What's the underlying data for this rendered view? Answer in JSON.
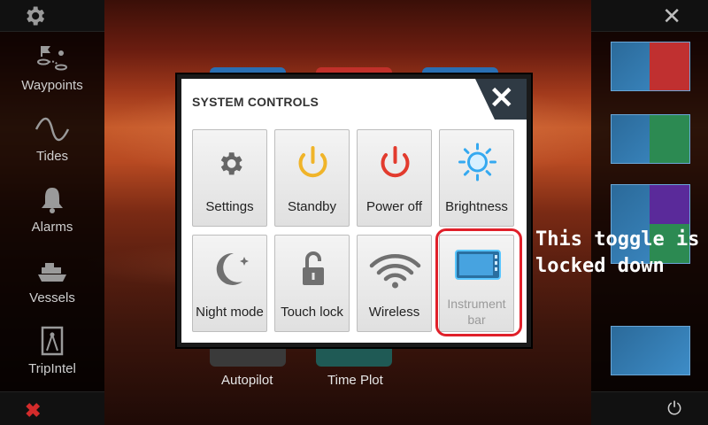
{
  "sidebar": {
    "items": [
      {
        "label": "Waypoints",
        "icon": "waypoints-icon"
      },
      {
        "label": "Tides",
        "icon": "tides-icon"
      },
      {
        "label": "Alarms",
        "icon": "bell-icon"
      },
      {
        "label": "Vessels",
        "icon": "ship-icon"
      },
      {
        "label": "TripIntel",
        "icon": "tripintel-icon"
      }
    ]
  },
  "background_apps": {
    "labels": [
      "Autopilot",
      "Time Plot"
    ]
  },
  "dialog": {
    "title": "SYSTEM CONTROLS",
    "close_label": "✕",
    "buttons": [
      {
        "label": "Settings",
        "icon": "gear-icon"
      },
      {
        "label": "Standby",
        "icon": "standby-icon"
      },
      {
        "label": "Power off",
        "icon": "power-icon"
      },
      {
        "label": "Brightness",
        "icon": "brightness-icon"
      },
      {
        "label": "Night mode",
        "icon": "moon-icon"
      },
      {
        "label": "Touch lock",
        "icon": "lock-icon"
      },
      {
        "label": "Wireless",
        "icon": "wifi-icon"
      },
      {
        "label_line1": "Instrument",
        "label_line2": "bar",
        "icon": "instrument-bar-icon",
        "disabled": true
      }
    ]
  },
  "annotation": {
    "line1": "This toggle is",
    "line2": "locked down"
  },
  "colors": {
    "accent_yellow": "#f0b429",
    "power_red": "#e23b2e",
    "brightness_blue": "#35a9f0",
    "highlight_red": "#e0202a",
    "dialog_header": "#2f3a44"
  }
}
